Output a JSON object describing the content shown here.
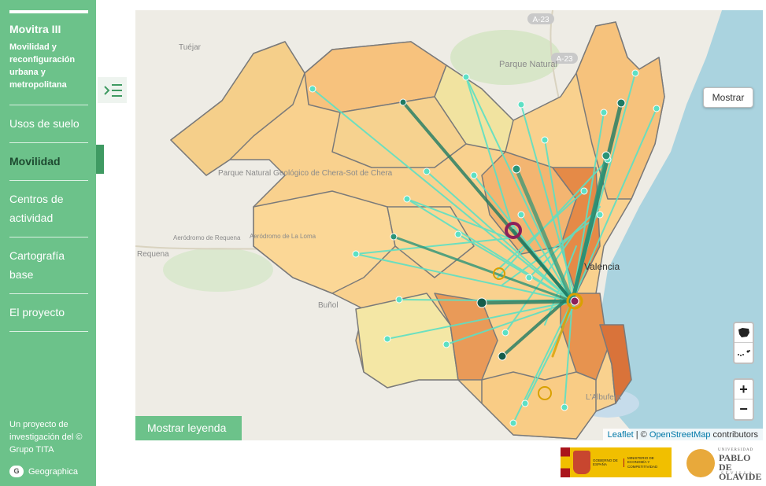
{
  "sidebar": {
    "title": "Movitra III",
    "subtitle": "Movilidad y reconfiguración urbana y metropolitana",
    "items": [
      {
        "label": "Usos de suelo",
        "active": false
      },
      {
        "label": "Movilidad",
        "active": true
      },
      {
        "label": "Centros de actividad",
        "active": false
      },
      {
        "label": "Cartografía base",
        "active": false
      },
      {
        "label": "El proyecto",
        "active": false
      }
    ],
    "credits": "Un proyecto de investigación del © Grupo TITA",
    "brand_icon": "G",
    "brand": "Geographica"
  },
  "map": {
    "labels": {
      "road_a23_top": "A-23",
      "road_a23_mid": "A-23",
      "tuejar": "Tuéjar",
      "parque_natural": "Parque Natural",
      "parque_chera": "Parque Natural Geológico de Chera-Sot de Chera",
      "aerodromo_1": "Aeródromo de Requena",
      "aerodromo_2": "Aeródromo de La Loma",
      "requena": "Requena",
      "bunol": "Buñol",
      "valencia": "Valencia",
      "albufera": "L'Albufera"
    },
    "show_button": "Mostrar",
    "legend_button": "Mostrar leyenda",
    "zoom_in": "+",
    "zoom_out": "−",
    "attribution": {
      "leaflet": "Leaflet",
      "sep": " | © ",
      "osm": "OpenStreetMap",
      "suffix": " contributors"
    }
  },
  "footer": {
    "gobierno_left": "GOBIERNO DE ESPAÑA",
    "gobierno_right": "MINISTERIO DE ECONOMÍA Y COMPETITIVIDAD",
    "upo_top": "UNIVERSIDAD",
    "upo_name_1": "PABLO DE",
    "upo_name_2": "OLAVIDE",
    "upo_city": "SEVILLA"
  },
  "colors": {
    "accent": "#6cc28a",
    "active": "#3f9a62",
    "flow": "#5de0c4",
    "flow_dark": "#1f7a63",
    "region_light": "#f5e9a8",
    "region_mid": "#f7cb8a",
    "region_dark": "#e8934f",
    "sea": "#aad3df"
  }
}
